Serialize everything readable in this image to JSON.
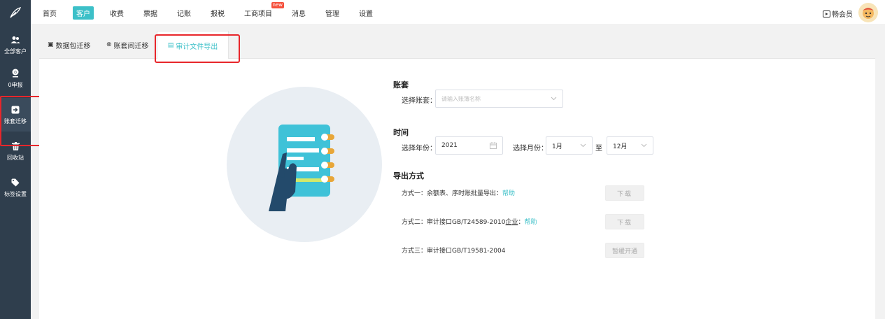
{
  "top_nav": {
    "items": [
      "首页",
      "客户",
      "收费",
      "票据",
      "记账",
      "报税",
      "工商项目",
      "消息",
      "管理",
      "设置"
    ],
    "active_index": 1,
    "badge_text": "new",
    "member_label": "畅会员"
  },
  "sidebar": {
    "items": [
      {
        "label": "全部客户",
        "icon": "users-icon"
      },
      {
        "label": "0申报",
        "icon": "zero-declare-icon"
      },
      {
        "label": "账套迁移",
        "icon": "migrate-icon"
      },
      {
        "label": "回收站",
        "icon": "trash-icon"
      },
      {
        "label": "标签设置",
        "icon": "tag-icon"
      }
    ],
    "active_index": 2
  },
  "tabs": [
    {
      "label": "数据包迁移",
      "icon": "package-icon"
    },
    {
      "label": "账套间迁移",
      "icon": "transfer-icon"
    },
    {
      "label": "审计文件导出",
      "icon": "file-icon"
    }
  ],
  "active_tab": 2,
  "form": {
    "ledger_section_title": "账套",
    "ledger_label": "选择账套：",
    "ledger_placeholder": "请输入账簿名称",
    "time_section_title": "时间",
    "year_label": "选择年份：",
    "year_value": "2021",
    "month_label": "选择月份：",
    "month_from": "1月",
    "month_to_sep": "至",
    "month_to": "12月",
    "export_section_title": "导出方式",
    "methods": [
      {
        "prefix": "方式一：余额表、序时账批量导出：",
        "underline": "",
        "suffix": "",
        "help": "帮助",
        "button": "下载"
      },
      {
        "prefix": "方式二：审计接口GB/T24589-2010",
        "underline": "企业",
        "suffix": "：",
        "help": "帮助",
        "button": "下载"
      },
      {
        "prefix": "方式三：审计接口GB/T19581-2004",
        "underline": "",
        "suffix": "",
        "help": "",
        "button": "暂缓开通"
      }
    ]
  },
  "colors": {
    "accent": "#3cc0c8",
    "sidebar_bg": "#2f3e4d",
    "highlight": "#e8262b",
    "badge": "#f5503c"
  }
}
